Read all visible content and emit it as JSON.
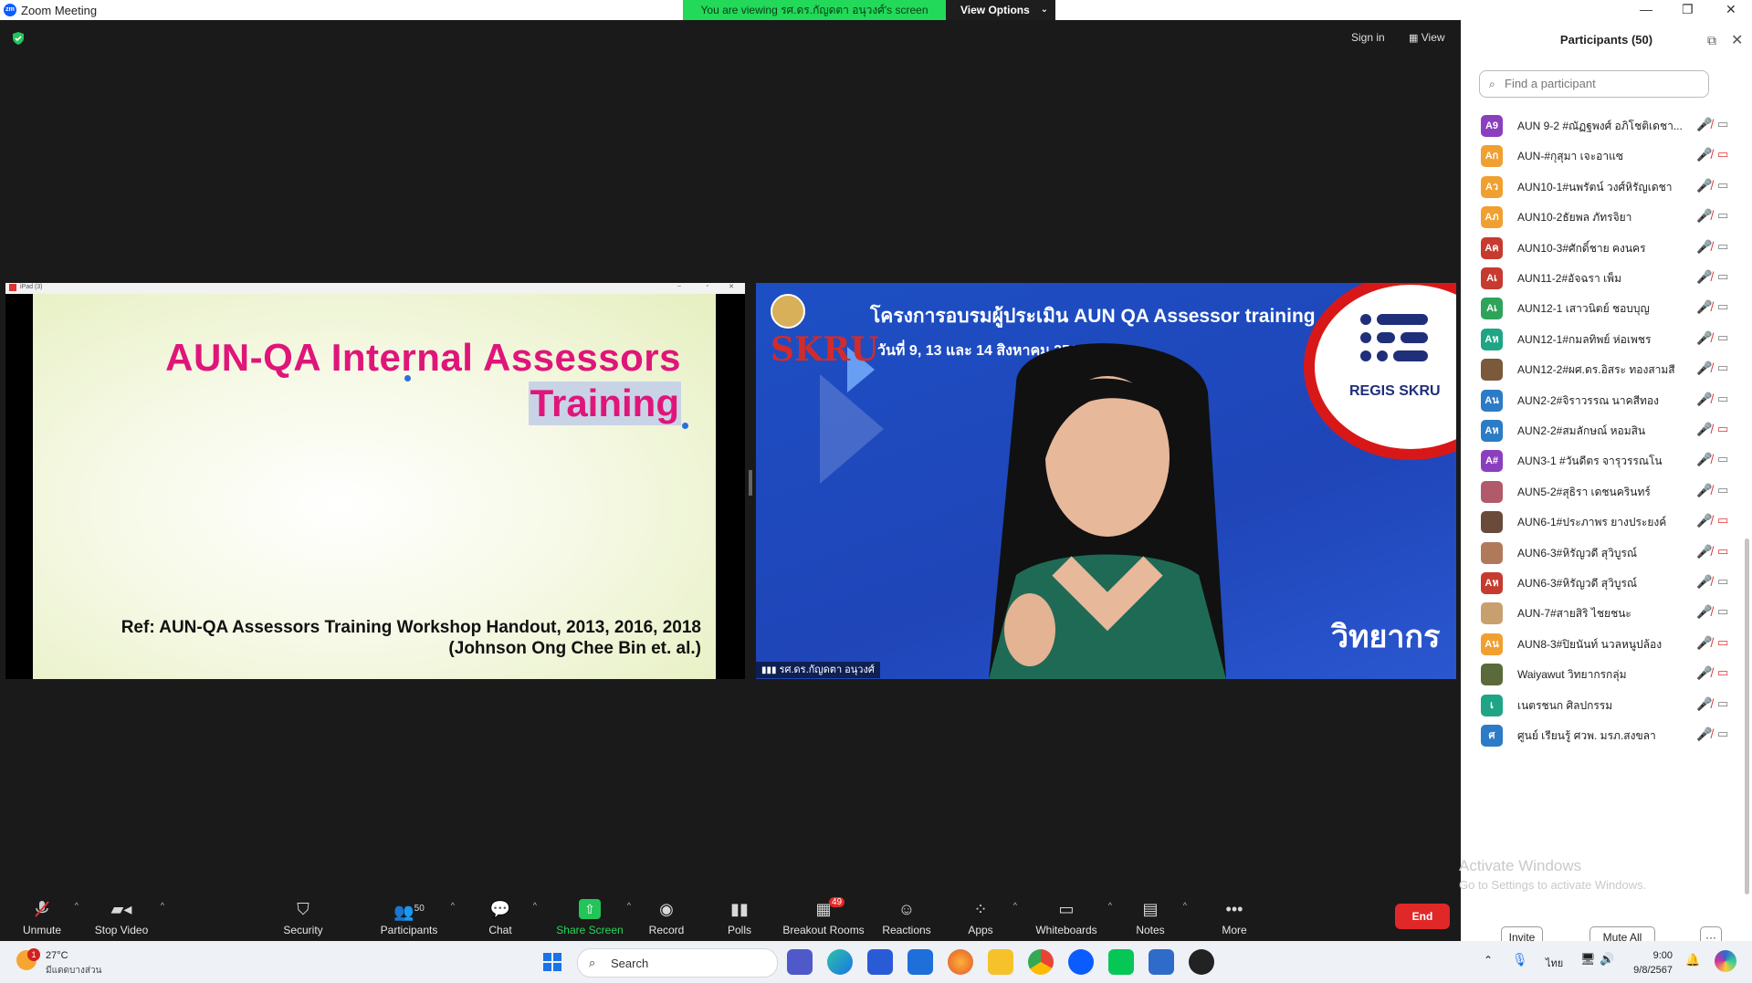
{
  "window": {
    "app_icon": "zm",
    "title": "Zoom Meeting",
    "controls": [
      "—",
      "❐",
      "✕"
    ]
  },
  "banner": {
    "viewing_text": "You are viewing รศ.ดร.กัญดตา อนุวงศ์'s screen",
    "view_options": "View Options"
  },
  "top_right": {
    "sign_in": "Sign in",
    "view": "View"
  },
  "shared_screen": {
    "window_title": "iPad (3)",
    "title_line1": "AUN-QA Internal Assessors",
    "title_line2": "Training",
    "ref_line1": "Ref: AUN-QA Assessors Training Workshop Handout, 2013, 2016, 2018",
    "ref_line2": "(Johnson Ong Chee Bin et. al.)"
  },
  "video": {
    "banner_line1": "โครงการอบรมผู้ประเมิน AUN QA Assessor training",
    "banner_line2": "วันที่ 9, 13 และ 14 สิงหาคม 2567",
    "skru_logo": "SKRU",
    "regis": "REGIS SKRU",
    "speaker_label": "วิทยากร",
    "name_tag": "รศ.ดร.กัญดตา อนุวงศ์"
  },
  "toolbar": {
    "unmute": "Unmute",
    "stop_video": "Stop Video",
    "security": "Security",
    "participants": "Participants",
    "participants_count": "50",
    "chat": "Chat",
    "share_screen": "Share Screen",
    "record": "Record",
    "polls": "Polls",
    "breakout_rooms": "Breakout Rooms",
    "breakout_count": "49",
    "reactions": "Reactions",
    "apps": "Apps",
    "whiteboards": "Whiteboards",
    "notes": "Notes",
    "more": "More",
    "end": "End"
  },
  "panel": {
    "title": "Participants (50)",
    "search_placeholder": "Find a participant",
    "invite": "Invite",
    "mute_all": "Mute All",
    "more": "···",
    "participants": [
      {
        "initials": "A9",
        "color": "#8b3fbf",
        "name": "AUN 9-2 #ณัฏฐพงศ์ อภิโชติเดชา...",
        "cam_off": false
      },
      {
        "initials": "Aก",
        "color": "#f0a030",
        "name": "AUN-#กุสุมา เจะอาแซ",
        "cam_off": true
      },
      {
        "initials": "Aว",
        "color": "#f0a030",
        "name": "AUN10-1#นพรัตน์ วงศ์หิรัญเดชา",
        "cam_off": false
      },
      {
        "initials": "Aภ",
        "color": "#f0a030",
        "name": "AUN10-2ธัยพล ภัทรจิยา",
        "cam_off": false
      },
      {
        "initials": "Aค",
        "color": "#c63a2f",
        "name": "AUN10-3#ศักดิ์ชาย คงนคร",
        "cam_off": false
      },
      {
        "initials": "Aเ",
        "color": "#c63a2f",
        "name": "AUN11-2#อัจฉรา เพ็ม",
        "cam_off": false
      },
      {
        "initials": "Aเ",
        "color": "#2fa35a",
        "name": "AUN12-1 เสาวนิตย์ ชอบบุญ",
        "cam_off": false
      },
      {
        "initials": "Aห",
        "color": "#1fa585",
        "name": "AUN12-1#กมลทิพย์ ห่อเพชร",
        "cam_off": false
      },
      {
        "initials": "",
        "color": "#7a5a3a",
        "name": "AUN12-2#ผศ.ดร.อิสระ ทองสามสี",
        "cam_off": false
      },
      {
        "initials": "Aน",
        "color": "#2b7bc6",
        "name": "AUN2-2#จิราวรรณ นาคสีทอง",
        "cam_off": false
      },
      {
        "initials": "Aห",
        "color": "#2b7bc6",
        "name": "AUN2-2#สมลักษณ์ หอมสิน",
        "cam_off": true
      },
      {
        "initials": "A#",
        "color": "#8b3fbf",
        "name": "AUN3-1 #วันดีตร จารุวรรณโน",
        "cam_off": false
      },
      {
        "initials": "",
        "color": "#b05a6a",
        "name": "AUN5-2#สุธิรา เดชนครินทร์",
        "cam_off": false
      },
      {
        "initials": "",
        "color": "#6a4a3a",
        "name": "AUN6-1#ประภาพร ยางประยงค์",
        "cam_off": true
      },
      {
        "initials": "",
        "color": "#b07a5a",
        "name": "AUN6-3#หิรัญวดี สุวิบูรณ์",
        "cam_off": true
      },
      {
        "initials": "Aห",
        "color": "#c63a2f",
        "name": "AUN6-3#หิรัญวดี สุวิบูรณ์",
        "cam_off": false
      },
      {
        "initials": "",
        "color": "#c8a070",
        "name": "AUN-7#สายสิริ ไชยชนะ",
        "cam_off": false
      },
      {
        "initials": "Aน",
        "color": "#f0a030",
        "name": "AUN8-3#ปิยนันท์ นวลหนูปล้อง",
        "cam_off": true
      },
      {
        "initials": "",
        "color": "#5a6a3a",
        "name": "Waiyawut วิทยากรกลุ่ม",
        "cam_off": true
      },
      {
        "initials": "เ",
        "color": "#1fa585",
        "name": "เนตรชนก ศิลปกรรม",
        "cam_off": false
      },
      {
        "initials": "ศ",
        "color": "#2b7bc6",
        "name": "ศูนย์ เรียนรู้ ศวพ. มรภ.สงขลา",
        "cam_off": false
      }
    ]
  },
  "watermark": {
    "line1": "Activate Windows",
    "line2": "Go to Settings to activate Windows."
  },
  "taskbar": {
    "weather_temp": "27°C",
    "weather_desc": "มีแดดบางส่วน",
    "weather_badge": "1",
    "search": "Search",
    "lang": "ไทย",
    "time": "9:00",
    "date": "9/8/2567"
  }
}
